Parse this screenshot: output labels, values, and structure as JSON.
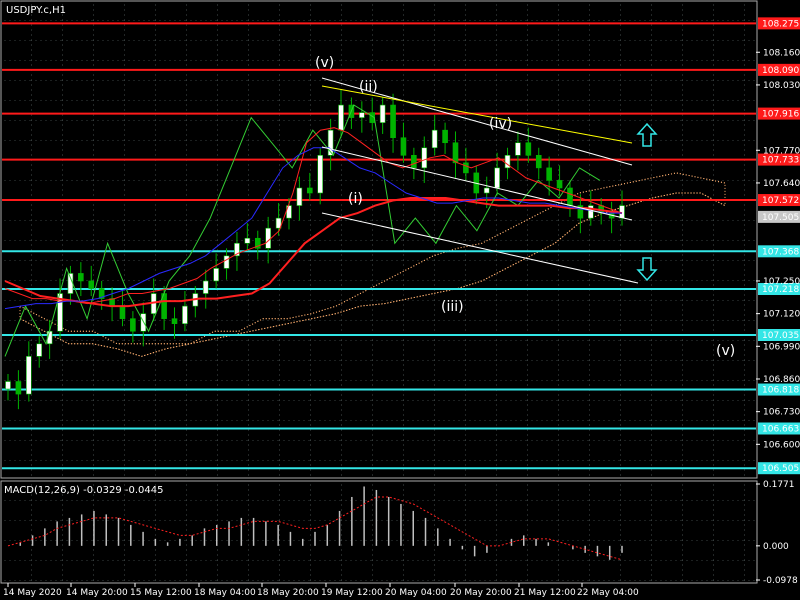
{
  "window": {
    "title": "USDJPY.c,H1"
  },
  "macd": {
    "label": "MACD(12,26,9) -0.0329 -0.0445"
  },
  "colors": {
    "background": "#000000",
    "grid": "#6f7f7f",
    "resistance": "#ff1a1a",
    "support": "#33e6e6",
    "price": "#ffffff",
    "candle_body": "#00b300",
    "bull_candle": "#ffffff",
    "ma_fast": "#ff2020",
    "ma_slow": "#2a2aff",
    "channel": "#ffffff",
    "trendline": "#ffff00",
    "cloud": "#ffb070",
    "chikou": "#33cc33",
    "macd_hist": "#c0c0c0",
    "macd_signal": "#ff2020",
    "up_arrow": "#33e6e6",
    "down_arrow": "#33e6e6"
  },
  "chart_data": {
    "type": "candlestick",
    "symbol": "USDJPY.c",
    "timeframe": "H1",
    "ylim": [
      106.47,
      108.36
    ],
    "y_ticks": [
      "108.160",
      "108.030",
      "107.770",
      "107.640",
      "107.250",
      "107.120",
      "106.990",
      "106.860",
      "106.730",
      "106.600"
    ],
    "x_ticks": [
      "14 May 2020",
      "14 May 20:00",
      "15 May 12:00",
      "18 May 04:00",
      "18 May 20:00",
      "19 May 12:00",
      "20 May 04:00",
      "20 May 20:00",
      "21 May 12:00",
      "22 May 04:00"
    ],
    "resistance_levels": [
      108.275,
      108.09,
      107.916,
      107.733,
      107.572
    ],
    "resistance_labels": [
      "108.275",
      "108.090",
      "107.916",
      "107.733",
      "107.572"
    ],
    "support_levels": [
      107.368,
      107.218,
      107.035,
      106.818,
      106.663,
      106.505
    ],
    "support_labels": [
      "107.368",
      "107.218",
      "107.035",
      "106.818",
      "106.663",
      "106.505"
    ],
    "current_price": 107.505,
    "current_price_label": "107.505",
    "wave_labels": [
      "(v)",
      "(ii)",
      "(iv)",
      "(i)",
      "(iii)",
      "(v)"
    ],
    "close": [
      106.85,
      106.8,
      106.95,
      107.0,
      107.05,
      107.2,
      107.28,
      107.25,
      107.22,
      107.18,
      107.15,
      107.1,
      107.05,
      107.12,
      107.2,
      107.1,
      107.08,
      107.15,
      107.2,
      107.25,
      107.3,
      107.35,
      107.4,
      107.42,
      107.38,
      107.46,
      107.5,
      107.55,
      107.62,
      107.6,
      107.75,
      107.85,
      107.95,
      107.9,
      107.92,
      107.88,
      107.95,
      107.82,
      107.75,
      107.7,
      107.78,
      107.85,
      107.8,
      107.72,
      107.68,
      107.6,
      107.62,
      107.7,
      107.75,
      107.8,
      107.75,
      107.7,
      107.65,
      107.62,
      107.55,
      107.5,
      107.55,
      107.52,
      107.5,
      107.55
    ],
    "ma_fast": [
      107.22,
      107.2,
      107.18,
      107.18,
      107.17,
      107.17,
      107.16,
      107.17,
      107.18,
      107.2,
      107.2,
      107.21,
      107.22,
      107.24,
      107.26,
      107.3,
      107.33,
      107.36,
      107.38,
      107.4,
      107.45,
      107.6,
      107.8,
      107.85,
      107.86,
      107.84,
      107.8,
      107.76,
      107.72,
      107.7,
      107.72,
      107.74,
      107.75,
      107.72,
      107.7,
      107.72,
      107.74,
      107.7,
      107.66,
      107.64,
      107.62,
      107.6,
      107.58,
      107.56,
      107.54,
      107.52
    ],
    "ma_slow": [
      107.14,
      107.15,
      107.16,
      107.16,
      107.17,
      107.17,
      107.18,
      107.2,
      107.22,
      107.25,
      107.28,
      107.3,
      107.32,
      107.35,
      107.4,
      107.45,
      107.5,
      107.6,
      107.7,
      107.75,
      107.78,
      107.78,
      107.74,
      107.7,
      107.68,
      107.64,
      107.6,
      107.58,
      107.56,
      107.56,
      107.57,
      107.58,
      107.58,
      107.57,
      107.56,
      107.56,
      107.55,
      107.54,
      107.53,
      107.52,
      107.52
    ],
    "ma_long": [
      107.25,
      107.22,
      107.19,
      107.18,
      107.17,
      107.16,
      107.15,
      107.15,
      107.16,
      107.17,
      107.17,
      107.18,
      107.18,
      107.19,
      107.2,
      107.24,
      107.32,
      107.4,
      107.45,
      107.5,
      107.52,
      107.55,
      107.57,
      107.58,
      107.58,
      107.58,
      107.57,
      107.56,
      107.55,
      107.55,
      107.55,
      107.55,
      107.54,
      107.54,
      107.53,
      107.52
    ],
    "chikou": [
      106.95,
      107.15,
      107.0,
      107.3,
      107.1,
      107.4,
      107.2,
      107.05,
      107.25,
      107.35,
      107.5,
      107.7,
      107.9,
      107.8,
      107.7,
      107.85,
      107.75,
      107.95,
      107.9,
      107.4,
      107.5,
      107.4,
      107.55,
      107.45,
      107.6,
      107.55,
      107.65,
      107.58,
      107.7,
      107.65
    ],
    "cloud_top": [
      107.15,
      107.1,
      107.05,
      107.05,
      107.0,
      107.0,
      107.0,
      107.0,
      107.05,
      107.05,
      107.1,
      107.1,
      107.12,
      107.15,
      107.2,
      107.25,
      107.3,
      107.35,
      107.38,
      107.4,
      107.45,
      107.5,
      107.55,
      107.6,
      107.62,
      107.64,
      107.66,
      107.68,
      107.66,
      107.64
    ],
    "cloud_bottom": [
      107.1,
      107.05,
      107.0,
      107.0,
      106.98,
      106.95,
      106.98,
      107.0,
      107.02,
      107.04,
      107.06,
      107.08,
      107.1,
      107.12,
      107.15,
      107.16,
      107.18,
      107.2,
      107.22,
      107.25,
      107.3,
      107.35,
      107.4,
      107.48,
      107.52,
      107.55,
      107.58,
      107.6,
      107.6,
      107.55
    ],
    "macd": {
      "ylim": [
        -0.0978,
        0.1771
      ],
      "y_ticks": [
        "0.1771",
        "0.000",
        "-0.0978"
      ],
      "histogram": [
        0.0,
        0.01,
        0.03,
        0.05,
        0.07,
        0.08,
        0.09,
        0.1,
        0.09,
        0.08,
        0.06,
        0.04,
        0.02,
        0.01,
        0.02,
        0.03,
        0.05,
        0.06,
        0.07,
        0.08,
        0.08,
        0.07,
        0.06,
        0.04,
        0.02,
        0.04,
        0.06,
        0.1,
        0.14,
        0.17,
        0.16,
        0.14,
        0.12,
        0.1,
        0.08,
        0.05,
        0.02,
        -0.01,
        -0.03,
        -0.02,
        0.0,
        0.02,
        0.03,
        0.02,
        0.01,
        0.0,
        -0.01,
        -0.02,
        -0.03,
        -0.04,
        -0.02
      ],
      "signal": [
        0.0,
        0.01,
        0.02,
        0.03,
        0.05,
        0.06,
        0.07,
        0.08,
        0.08,
        0.08,
        0.07,
        0.06,
        0.05,
        0.04,
        0.03,
        0.03,
        0.04,
        0.05,
        0.05,
        0.06,
        0.07,
        0.07,
        0.07,
        0.06,
        0.05,
        0.05,
        0.06,
        0.08,
        0.1,
        0.12,
        0.14,
        0.14,
        0.13,
        0.12,
        0.1,
        0.08,
        0.06,
        0.04,
        0.02,
        0.0,
        0.0,
        0.01,
        0.02,
        0.02,
        0.02,
        0.01,
        0.0,
        -0.01,
        -0.02,
        -0.03,
        -0.04
      ]
    }
  }
}
